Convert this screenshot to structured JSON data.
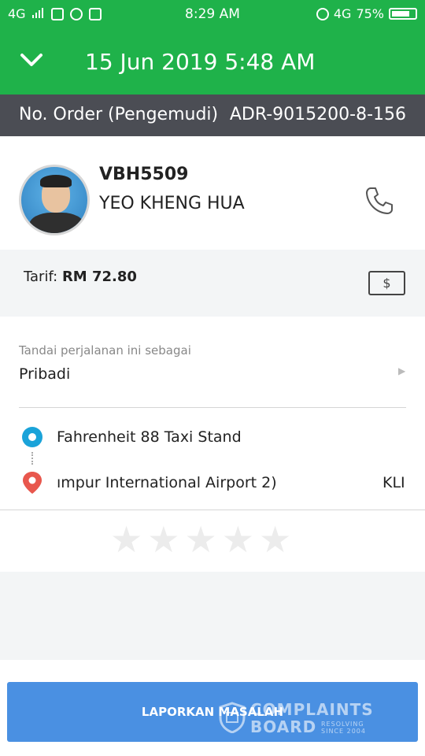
{
  "status_bar": {
    "network_left": "4G",
    "time": "8:29 AM",
    "network_right": "4G",
    "battery": "75%"
  },
  "header": {
    "title": "15 Jun 2019 5:48 AM"
  },
  "order": {
    "label": "No. Order (Pengemudi)",
    "number": "ADR-9015200-8-156"
  },
  "driver": {
    "plate": "VBH5509",
    "name": "YEO KHENG HUA"
  },
  "fare": {
    "label": "Tarif: ",
    "amount": "RM 72.80",
    "payment_symbol": "$"
  },
  "trip_tag": {
    "hint": "Tandai perjalanan ini sebagai",
    "value": "Pribadi"
  },
  "route": {
    "pickup": "Fahrenheit 88 Taxi Stand",
    "dropoff": "ımpur International Airport 2)",
    "dropoff_tail": "KLI"
  },
  "rating": {
    "max_stars": 5,
    "selected": 0
  },
  "actions": {
    "report_label": "LAPORKAN MASALAH"
  },
  "watermark": {
    "line1": "COMPLAINTS",
    "line2": "BOARD",
    "tag1": "RESOLVING",
    "tag2": "SINCE 2004"
  },
  "colors": {
    "brand_green": "#1fb24a",
    "order_bar": "#4b4d54",
    "button_blue": "#4a90e2",
    "pickup_blue": "#1aa3d9",
    "dropoff_red": "#e8574d"
  }
}
